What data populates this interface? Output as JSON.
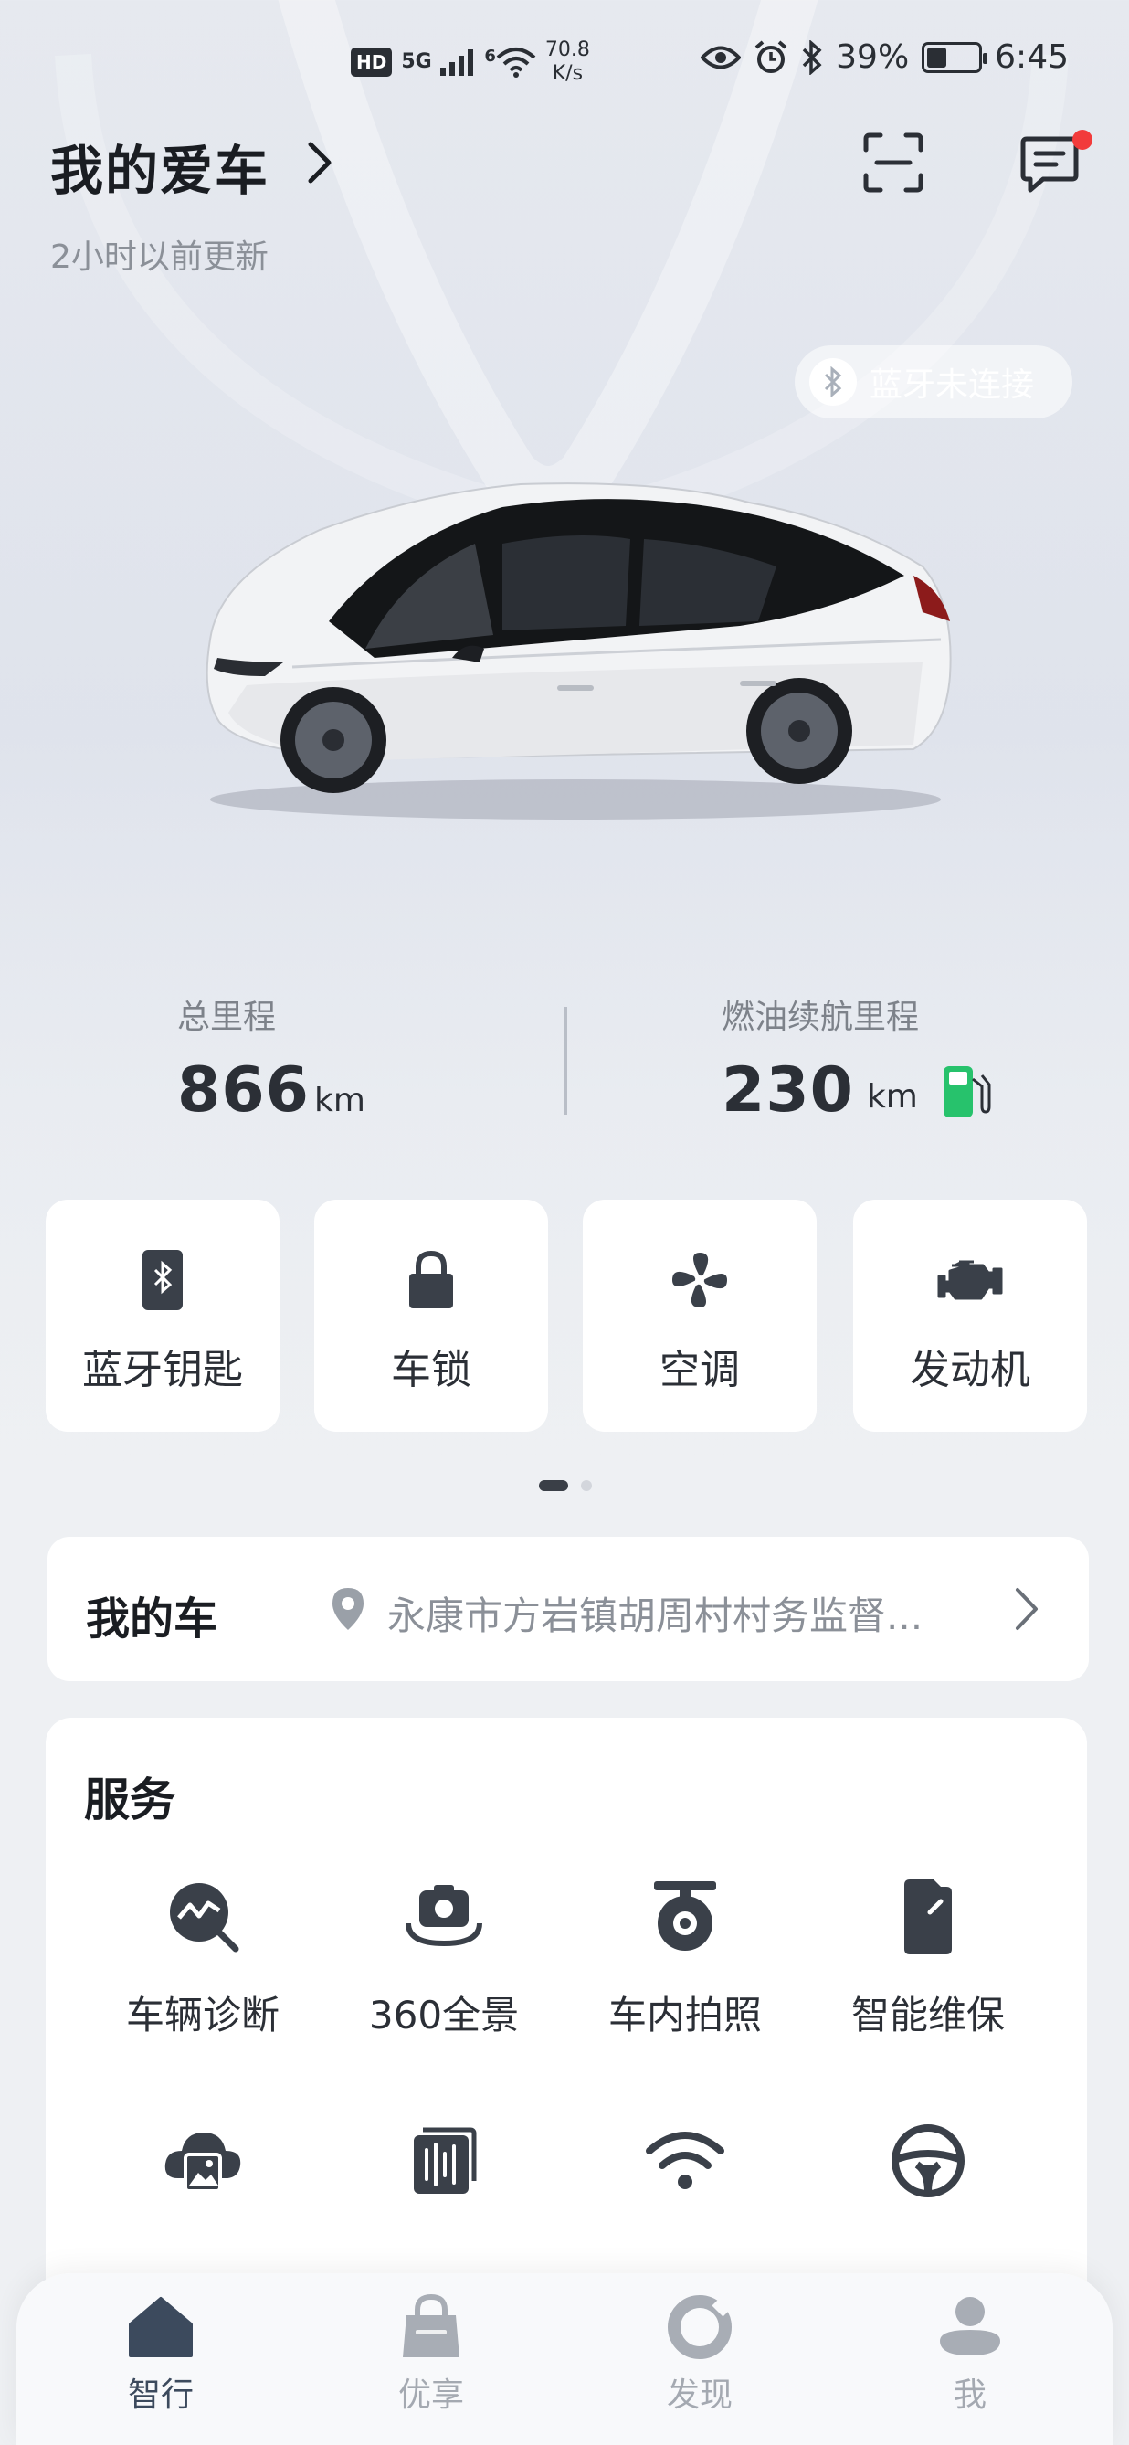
{
  "status_bar": {
    "hd": "HD",
    "signal": "5G",
    "wifi_badge": "6",
    "net_speed_value": "70.8",
    "net_speed_unit": "K/s",
    "battery": "39%",
    "battery_level": 0.39,
    "time": "6:45"
  },
  "header": {
    "title": "我的爱车",
    "updated": "2小时以前更新",
    "has_unread_message": true
  },
  "bluetooth_status": "蓝牙未连接",
  "stats": {
    "total_mileage_label": "总里程",
    "total_mileage_value": "866",
    "total_mileage_unit": "km",
    "fuel_range_label": "燃油续航里程",
    "fuel_range_value": "230",
    "fuel_range_unit": "km"
  },
  "quick_actions": [
    {
      "label": "蓝牙钥匙",
      "icon": "bluetooth-key-icon"
    },
    {
      "label": "车锁",
      "icon": "lock-icon"
    },
    {
      "label": "空调",
      "icon": "fan-icon"
    },
    {
      "label": "发动机",
      "icon": "engine-icon"
    }
  ],
  "pager": {
    "pages": 2,
    "active": 1
  },
  "my_car": {
    "title": "我的车",
    "location": "永康市方岩镇胡周村村务监督..."
  },
  "service": {
    "title": "服务",
    "items": [
      {
        "label": "车辆诊断",
        "icon": "diagnosis-icon"
      },
      {
        "label": "360全景",
        "icon": "panorama-camera-icon"
      },
      {
        "label": "车内拍照",
        "icon": "in-car-camera-icon"
      },
      {
        "label": "智能维保",
        "icon": "maintenance-icon"
      },
      {
        "label": "",
        "icon": "cloud-album-icon"
      },
      {
        "label": "",
        "icon": "recorder-icon"
      },
      {
        "label": "",
        "icon": "wifi-icon"
      },
      {
        "label": "",
        "icon": "steering-wheel-icon"
      }
    ]
  },
  "bottom_nav": [
    {
      "label": "智行",
      "icon": "home-icon",
      "active": true
    },
    {
      "label": "优享",
      "icon": "shopping-bag-icon",
      "active": false
    },
    {
      "label": "发现",
      "icon": "discover-icon",
      "active": false
    },
    {
      "label": "我",
      "icon": "profile-icon",
      "active": false
    }
  ],
  "colors": {
    "accent_dark": "#3c4a5d",
    "fuel_green": "#27c26c",
    "badge_red": "#f23b3b"
  }
}
